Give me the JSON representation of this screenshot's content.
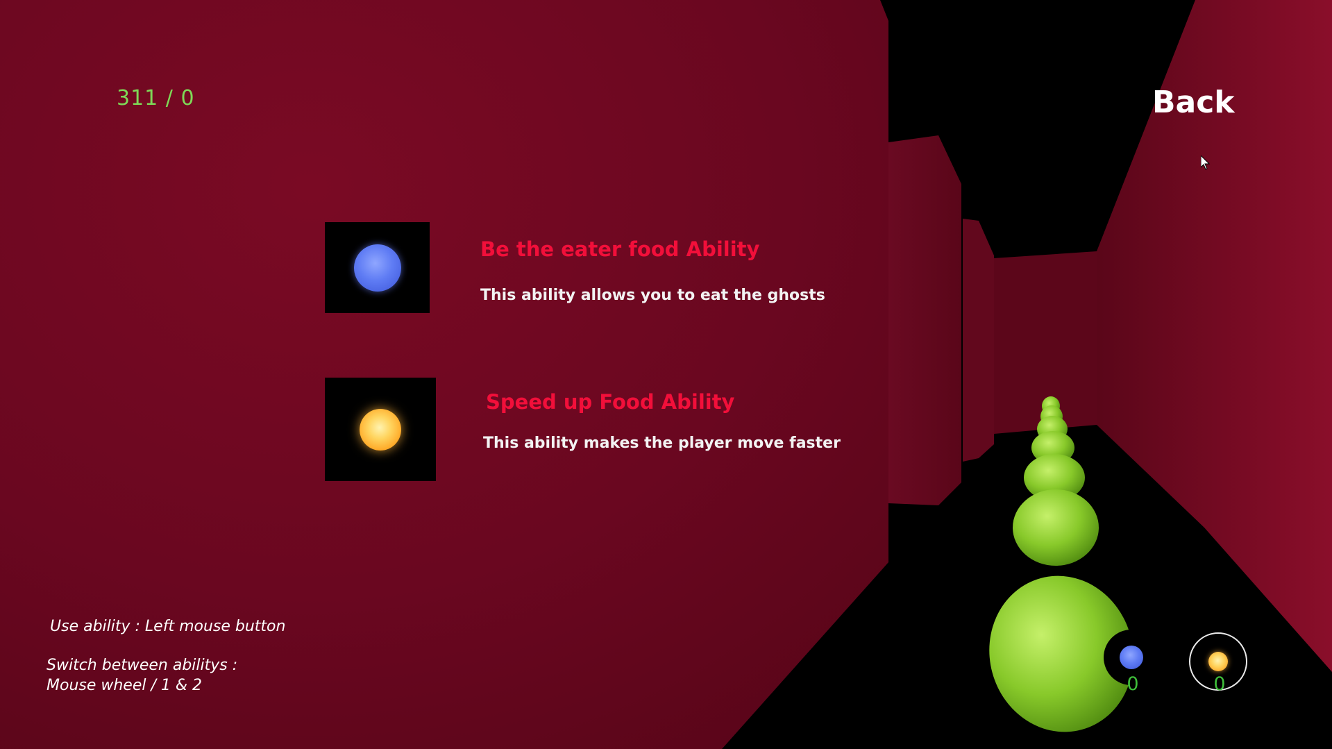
{
  "hud": {
    "score": "311 / 0",
    "back_label": "Back"
  },
  "abilities": [
    {
      "title": "Be the eater food Ability",
      "description": "This ability allows you to eat the ghosts",
      "icon": "blue-orb-icon",
      "color": "#5f7cf4"
    },
    {
      "title": "Speed up Food Ability",
      "description": "This ability makes the player move faster",
      "icon": "golden-orb-icon",
      "color": "#ffc040"
    }
  ],
  "controls": {
    "use_ability": "Use ability : Left mouse button",
    "switch_line1": "Switch between abilitys :",
    "switch_line2": "Mouse wheel / 1 & 2"
  },
  "inventory": [
    {
      "icon": "blue-orb-icon",
      "count": "0",
      "selected": false
    },
    {
      "icon": "golden-orb-icon",
      "count": "0",
      "selected": true
    }
  ],
  "colors": {
    "wall_red": "#7a0a22",
    "title_red": "#f20f3a",
    "counter_green": "#3fbf3a",
    "score_green": "#7ed957",
    "snake_green": "#8cd02a"
  }
}
